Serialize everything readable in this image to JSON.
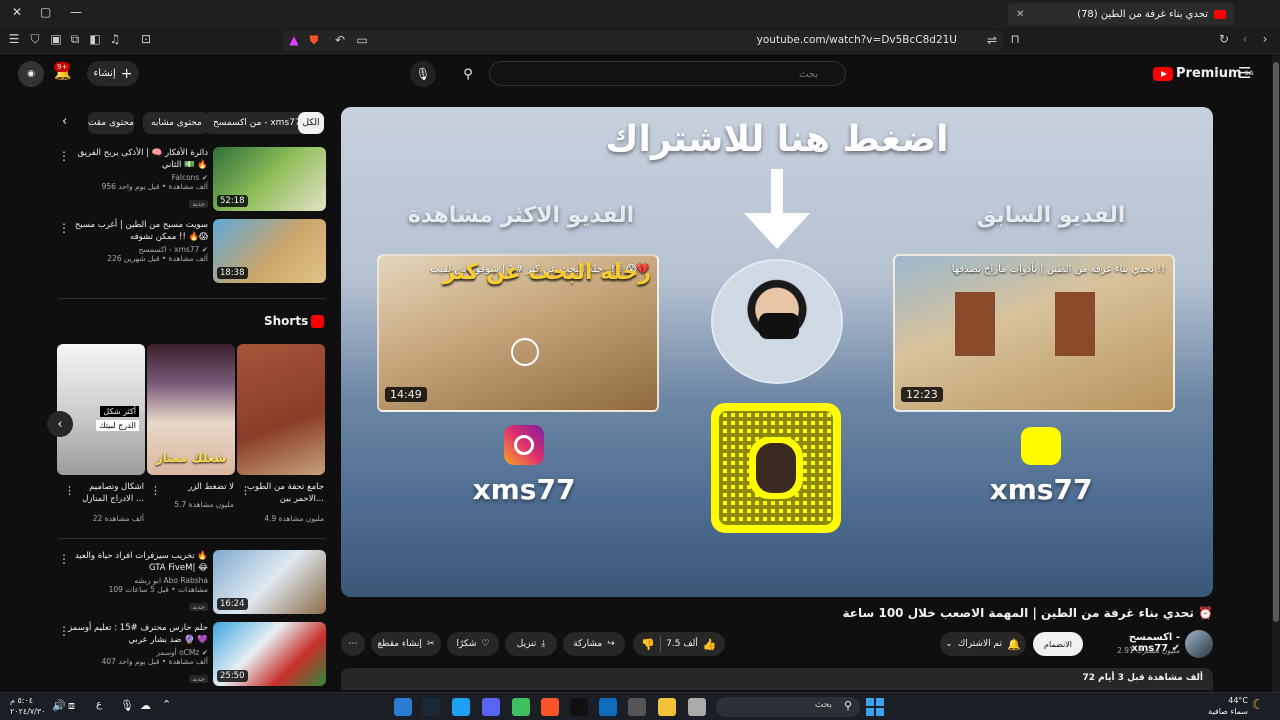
{
  "browser": {
    "tab_title": "(78) تحدي بناء غرفة من الطين",
    "url": "youtube.com/watch?v=Dv5BcC8d21U"
  },
  "header": {
    "logo_text": "Premium",
    "logo_region": "SA",
    "search_placeholder": "بحث",
    "create_label": "إنشاء",
    "notifications_count": "9+"
  },
  "chips": [
    "الكل",
    "من اكسمسح - xms77",
    "محتوى مشابه",
    "محتوى مقت"
  ],
  "sidebar_videos_top": [
    {
      "title": "دائرة الأفكار 🧠 | الأذكى يربح الفريق الثاني 💵 🔥",
      "channel": "Falcons ✔",
      "views": "956 ألف مشاهدة • قبل يوم واحد",
      "badge": "جديد",
      "duration": "52:18"
    },
    {
      "title": "سويت مسبح من الطين | أغرب مسبح ممكن تشوفه !! 🔥😱",
      "channel": "اكسمسح - xms77 ✔",
      "views": "226 ألف مشاهدة • قبل شهرين",
      "badge": "",
      "duration": "18:38"
    }
  ],
  "shorts": {
    "heading": "Shorts",
    "items": [
      {
        "title": "جامع تحفة من الطوب الاحمر بين...",
        "views": "4.9 مليون مشاهدة"
      },
      {
        "title": "لا تضغط الزر",
        "views": "5.7 مليون مشاهدة"
      },
      {
        "title": "اشكال وتصاميم الادراج المنازل ...",
        "views": "22 ألف مشاهدة"
      }
    ],
    "overlay_texts": [
      "شغلك ممتاز",
      "أكثر شكل",
      "الدرج لبيتك"
    ]
  },
  "sidebar_videos_bottom": [
    {
      "title": "تخريب سيرفرات افراد حياة والعيد 🔥 GTA FiveM| 😂",
      "channel": "ابو ربشه Abo Rabsha",
      "views": "109 مشاهدات • قبل 5 ساعات",
      "badge": "جديد",
      "duration": "16:24"
    },
    {
      "title": "حلم حارس محترف #15 : تعليم أوسمز ضد بشار عربي 🔮 💜",
      "channel": "أوسمز oCMz ✔",
      "views": "407 ألف مشاهدة • قبل يوم واحد",
      "badge": "جديد",
      "duration": "25:50"
    }
  ],
  "player": {
    "headline": "اضغط هنا للاشتراك",
    "left_label": "الفديو الاكثر مشاهدة",
    "right_label": "الفديو السابق",
    "left_card_title": "رحلة البحث عن كنز #1 | شوفوا اش لقيت !!! 😱💔",
    "left_card_overlay": "رحلة البحث عن كنز",
    "left_card_duration": "14:49",
    "right_card_title": "تحدي بناء غرفة من الطين | بأدوات ماراح تصدقها !!",
    "right_card_duration": "12:23",
    "handle_left": "xms77",
    "handle_right": "xms77"
  },
  "video": {
    "title": "تحدي بناء غرفة من الطين | المهمة الاصعب خلال 100 ساعة ⏰",
    "channel": "اكسمسح - xms77 ✔",
    "subs": "2.91 مليون مشترك",
    "join_label": "الانضمام",
    "subscribed_label": "تم الاشتراك",
    "likes": "7.5 ألف",
    "share_label": "مشاركة",
    "download_label": "تنزيل",
    "thanks_label": "شكرًا",
    "clip_label": "إنشاء مقطع",
    "views_line": "72 ألف مشاهدة قبل 3 أيام"
  },
  "taskbar": {
    "search_placeholder": "بحث",
    "time": "٥:٠٤ م",
    "date": "٢٠٢٤/٧/٣٠",
    "weather_temp": "44°C",
    "weather_desc": "سماء صافية",
    "lang": "ع"
  }
}
